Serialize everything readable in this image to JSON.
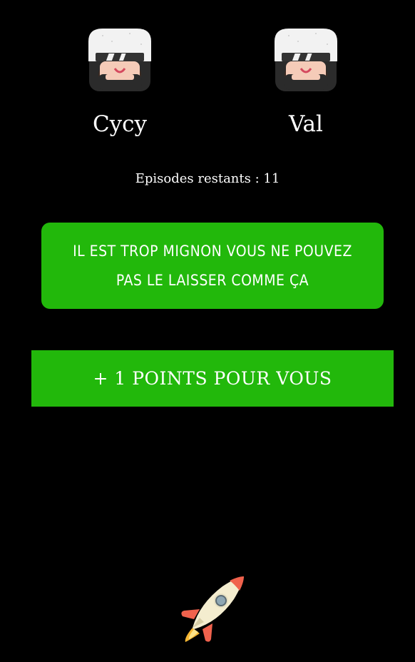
{
  "players": [
    {
      "name": "Cycy",
      "avatar_icon": "helmet-avatar-icon"
    },
    {
      "name": "Val",
      "avatar_icon": "helmet-avatar-icon"
    }
  ],
  "episodes_label": "Episodes restants : 11",
  "challenge": {
    "text": "IL EST TROP MIGNON VOUS NE POUVEZ PAS LE LAISSER COMME ÇA"
  },
  "points_button": {
    "label": "+ 1 POINTS POUR VOUS"
  },
  "rocket_icon": "rocket-icon",
  "colors": {
    "background": "#000000",
    "accent_green": "#22b80b",
    "text": "#ffffff"
  }
}
